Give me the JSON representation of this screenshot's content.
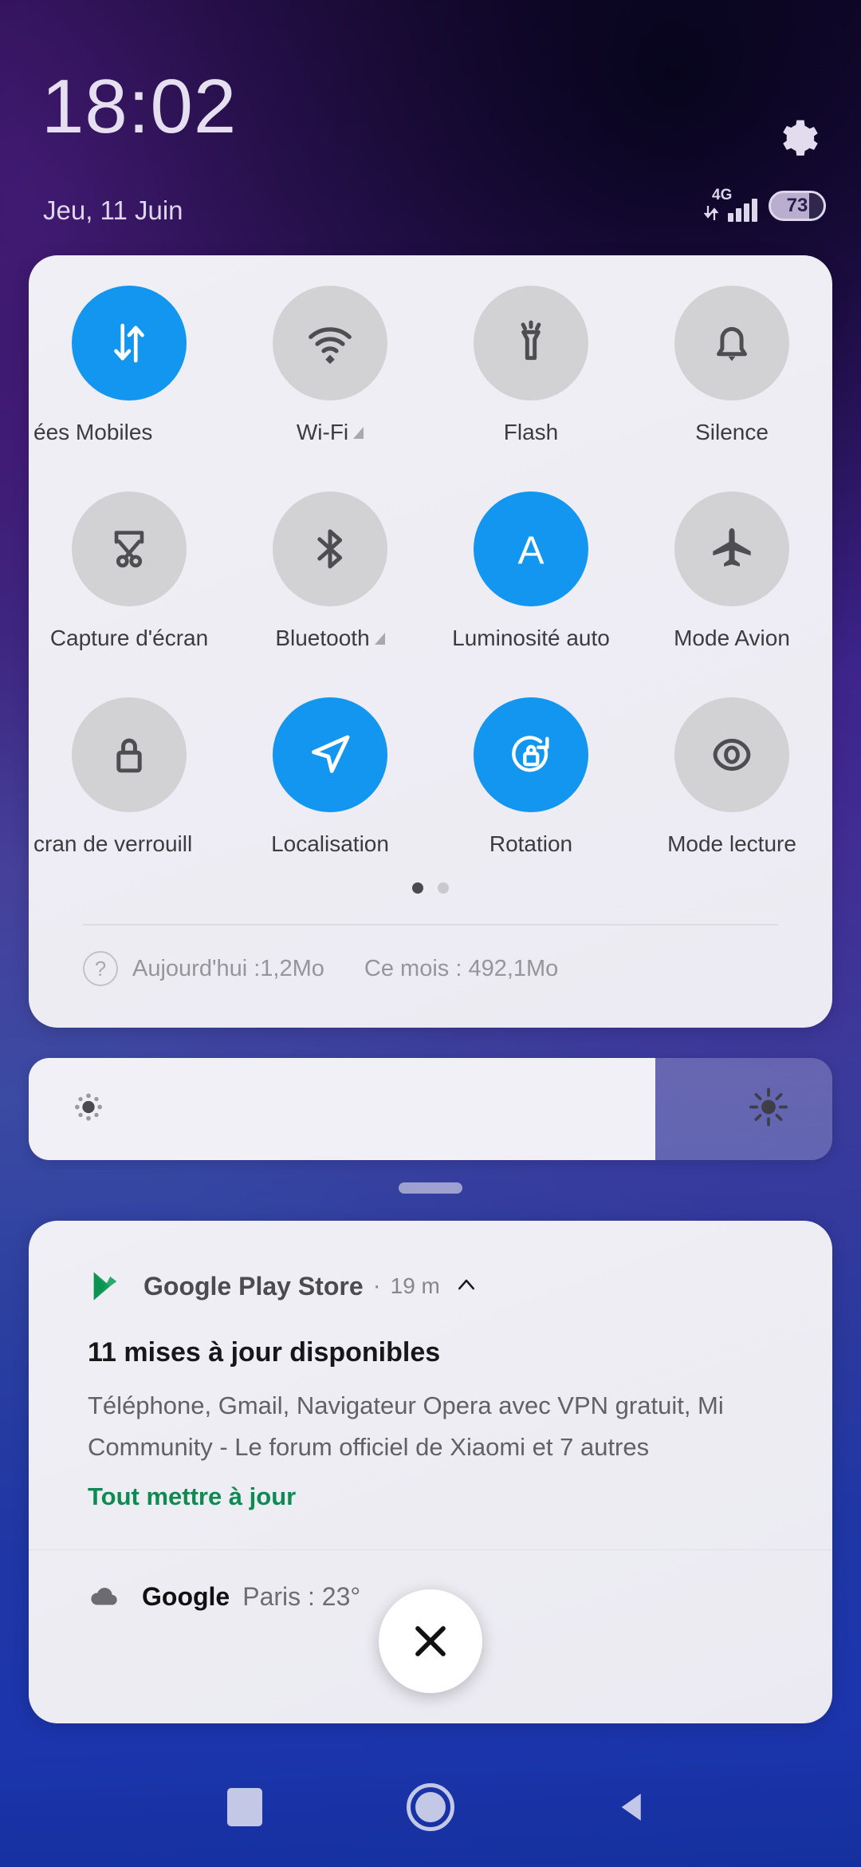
{
  "statusbar": {
    "clock": "18:02",
    "date": "Jeu, 11 Juin",
    "network_type": "4G",
    "battery_percent": "73",
    "settings_icon": "gear-icon",
    "signal_icon": "signal-bars-icon",
    "data_arrows_icon": "data-transfer-icon",
    "battery_icon": "battery-icon"
  },
  "quick_settings": {
    "tiles": [
      {
        "label": "ées Mobiles",
        "icon": "mobile-data-icon",
        "active": true,
        "badge": ""
      },
      {
        "label": "Wi-Fi",
        "icon": "wifi-icon",
        "active": false,
        "badge": "triangle"
      },
      {
        "label": "Flash",
        "icon": "flashlight-icon",
        "active": false,
        "badge": ""
      },
      {
        "label": "Silence",
        "icon": "bell-icon",
        "active": false,
        "badge": ""
      },
      {
        "label": "Capture d'écran",
        "icon": "screenshot-icon",
        "active": false,
        "badge": ""
      },
      {
        "label": "Bluetooth",
        "icon": "bluetooth-icon",
        "active": false,
        "badge": "triangle"
      },
      {
        "label": "Luminosité auto",
        "icon": "auto-brightness-icon",
        "active": true,
        "badge": ""
      },
      {
        "label": "Mode Avion",
        "icon": "airplane-icon",
        "active": false,
        "badge": ""
      },
      {
        "label": "cran de verrouill",
        "icon": "lock-icon",
        "active": false,
        "badge": ""
      },
      {
        "label": "Localisation",
        "icon": "location-arrow-icon",
        "active": true,
        "badge": ""
      },
      {
        "label": "Rotation",
        "icon": "rotation-lock-icon",
        "active": true,
        "badge": ""
      },
      {
        "label": "Mode lecture",
        "icon": "eye-icon",
        "active": false,
        "badge": ""
      }
    ],
    "page_dots": {
      "count": 2,
      "active_index": 0
    },
    "data_usage": {
      "help_icon": "question-mark-icon",
      "today": "Aujourd'hui :1,2Mo",
      "this_month": "Ce mois : 492,1Mo"
    }
  },
  "brightness": {
    "level_percent": 78,
    "low_icon": "brightness-low-icon",
    "high_icon": "brightness-high-icon",
    "drag_handle": "panel-drag-handle"
  },
  "notifications": {
    "items": [
      {
        "app": "Google Play Store",
        "app_icon": "play-store-icon",
        "separator": "·",
        "time": "19 m",
        "expand_icon": "chevron-up-icon",
        "title": "11 mises à jour disponibles",
        "body": "Téléphone, Gmail, Navigateur Opera avec VPN gratuit, Mi Community - Le forum officiel de Xiaomi et 7 autres",
        "action_label": "Tout mettre à jour"
      },
      {
        "app": "Google",
        "app_icon": "cloud-icon",
        "text": "Paris : 23°"
      }
    ],
    "clear_all_icon": "close-icon"
  },
  "navbar": {
    "recents_icon": "recents-square-icon",
    "home_icon": "home-circle-icon",
    "back_icon": "back-triangle-icon"
  },
  "colors": {
    "accent_blue": "#1296f0",
    "action_green": "#0f8a52",
    "panel_bg": "#f0eff5",
    "tile_off": "#d2d1d4"
  }
}
